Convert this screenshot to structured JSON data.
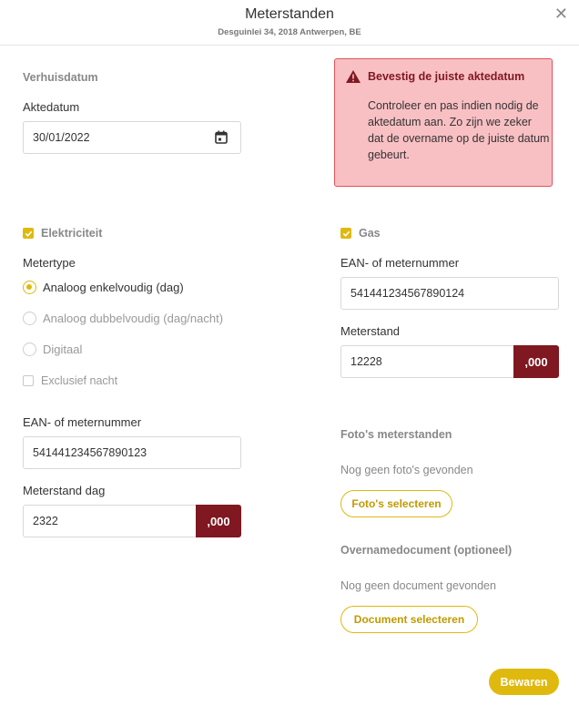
{
  "header": {
    "title": "Meterstanden",
    "subtitle": "Desguinlei 34, 2018 Antwerpen, BE"
  },
  "icons": {
    "close": "close-icon",
    "calendar": "calendar-icon",
    "warning": "warning-icon",
    "check": "check-icon"
  },
  "colors": {
    "accent": "#e0b90f",
    "danger_dark": "#7f1820",
    "alert_bg": "#f9c0c4"
  },
  "move": {
    "section_label": "Verhuisdatum",
    "date_label": "Aktedatum",
    "date_value": "30/01/2022"
  },
  "alert": {
    "title": "Bevestig de juiste aktedatum",
    "body": "Controleer en pas indien nodig de aktedatum aan. Zo zijn we zeker dat de overname op de juiste datum gebeurt."
  },
  "electricity": {
    "label": "Elektriciteit",
    "checked": true,
    "metertype_label": "Metertype",
    "options": [
      {
        "label": "Analoog enkelvoudig (dag)",
        "selected": true,
        "disabled": false
      },
      {
        "label": "Analoog dubbelvoudig (dag/nacht)",
        "selected": false,
        "disabled": true
      },
      {
        "label": "Digitaal",
        "selected": false,
        "disabled": true
      }
    ],
    "exclusive_night_label": "Exclusief nacht",
    "exclusive_night_checked": false,
    "ean_label": "EAN- of meternummer",
    "ean_value": "541441234567890123",
    "reading_label": "Meterstand dag",
    "reading_value": "2322",
    "reading_suffix": ",000"
  },
  "gas": {
    "label": "Gas",
    "checked": true,
    "ean_label": "EAN- of meternummer",
    "ean_value": "541441234567890124",
    "reading_label": "Meterstand",
    "reading_value": "12228",
    "reading_suffix": ",000"
  },
  "photos": {
    "title": "Foto's meterstanden",
    "empty": "Nog geen foto's gevonden",
    "button": "Foto's selecteren"
  },
  "document": {
    "title": "Overnamedocument (optioneel)",
    "empty": "Nog geen document gevonden",
    "button": "Document selecteren"
  },
  "save_label": "Bewaren"
}
